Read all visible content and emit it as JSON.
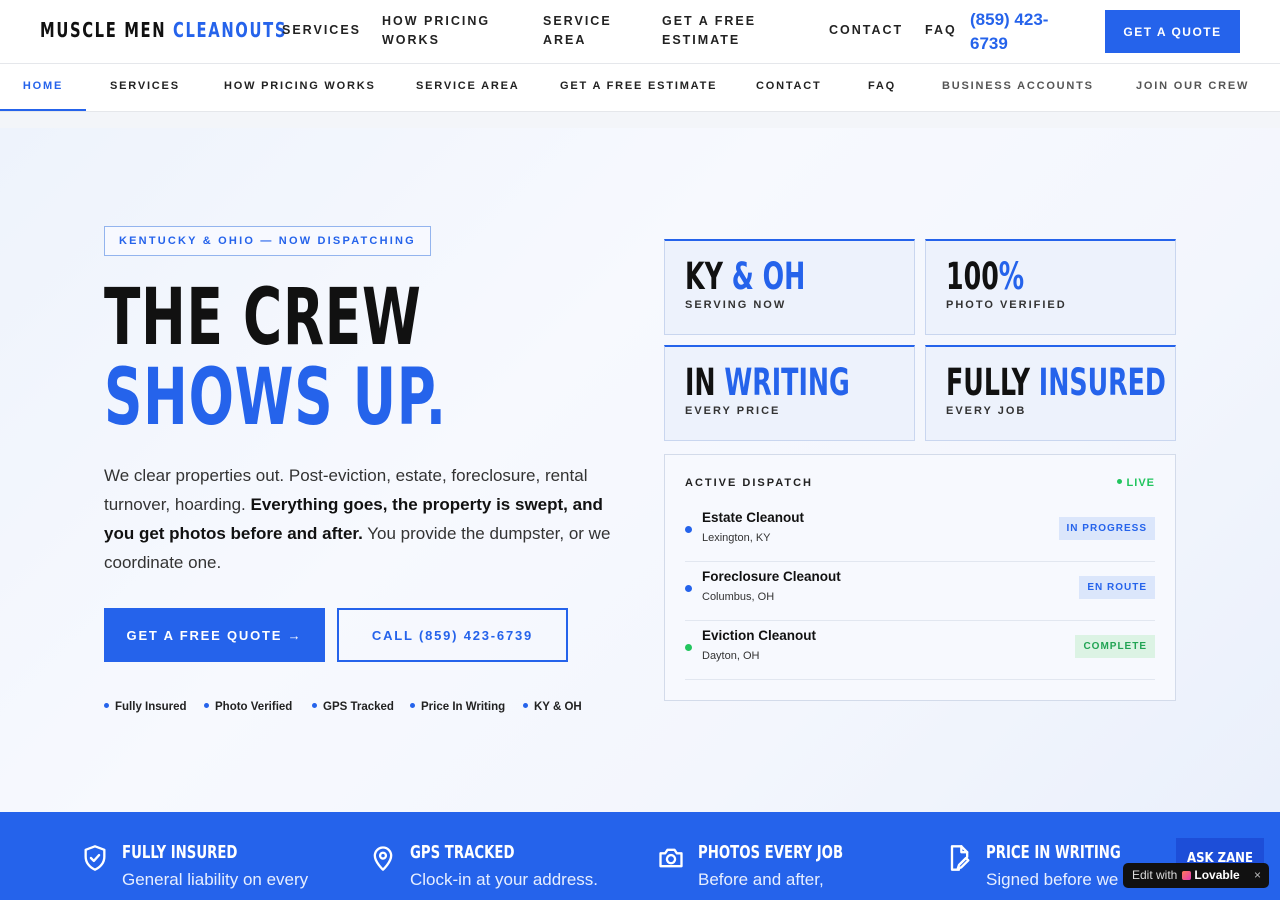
{
  "header": {
    "logo_main": "MUSCLE MEN",
    "logo_accent": "CLEANOUTS",
    "nav": [
      "SERVICES",
      "HOW PRICING WORKS",
      "SERVICE AREA",
      "GET A FREE ESTIMATE",
      "CONTACT",
      "FAQ"
    ],
    "phone": "(859) 423-6739",
    "quote_label": "GET A QUOTE"
  },
  "subnav": {
    "items": [
      "HOME",
      "SERVICES",
      "HOW PRICING WORKS",
      "SERVICE AREA",
      "GET A FREE ESTIMATE",
      "CONTACT",
      "FAQ",
      "BUSINESS ACCOUNTS",
      "JOIN OUR CREW"
    ],
    "active": "HOME"
  },
  "hero": {
    "kicker": "KENTUCKY & OHIO — NOW DISPATCHING",
    "headline_line1": "THE CREW",
    "headline_line2": "SHOWS UP.",
    "lead_part1": "We clear properties out. Post-eviction, estate, foreclosure, rental turnover, hoarding. ",
    "lead_bold": "Everything goes, the property is swept, and you get photos before and after.",
    "lead_part2": " You provide the dumpster, or we coordinate one.",
    "cta_primary": "GET A FREE QUOTE →",
    "cta_secondary": "CALL (859) 423-6739",
    "trust_items": [
      "Fully Insured",
      "Photo Verified",
      "GPS Tracked",
      "Price In Writing",
      "KY & OH"
    ]
  },
  "stats": [
    {
      "value_a": "KY",
      "value_b": " & OH",
      "label": "SERVING NOW"
    },
    {
      "value_a": "100",
      "value_b": "%",
      "label": "PHOTO VERIFIED"
    },
    {
      "value_a": "IN",
      "value_b": " WRITING",
      "label": "EVERY PRICE"
    },
    {
      "value_a": "FULLY",
      "value_b": " INSURED",
      "label": "EVERY JOB"
    }
  ],
  "dispatch": {
    "title": "ACTIVE DISPATCH",
    "live_label": "LIVE",
    "jobs": [
      {
        "name": "Estate Cleanout",
        "location": "Lexington, KY",
        "status": "IN PROGRESS"
      },
      {
        "name": "Foreclosure Cleanout",
        "location": "Columbus, OH",
        "status": "EN ROUTE"
      },
      {
        "name": "Eviction Cleanout",
        "location": "Dayton, OH",
        "status": "COMPLETE"
      }
    ]
  },
  "features": [
    {
      "icon": "shield-check-icon",
      "title": "FULLY INSURED",
      "text": "General liability on every"
    },
    {
      "icon": "map-pin-icon",
      "title": "GPS TRACKED",
      "text": "Clock-in at your address."
    },
    {
      "icon": "camera-icon",
      "title": "PHOTOS EVERY JOB",
      "text": "Before and after,"
    },
    {
      "icon": "document-edit-icon",
      "title": "PRICE IN WRITING",
      "text": "Signed before we"
    }
  ],
  "widgets": {
    "ask_label": "ASK ZANE",
    "lovable_prefix": "Edit with",
    "lovable_brand": "Lovable",
    "lovable_close": "×"
  },
  "colors": {
    "accent": "#2563eb",
    "live": "#22c55e",
    "dark": "#111111"
  }
}
